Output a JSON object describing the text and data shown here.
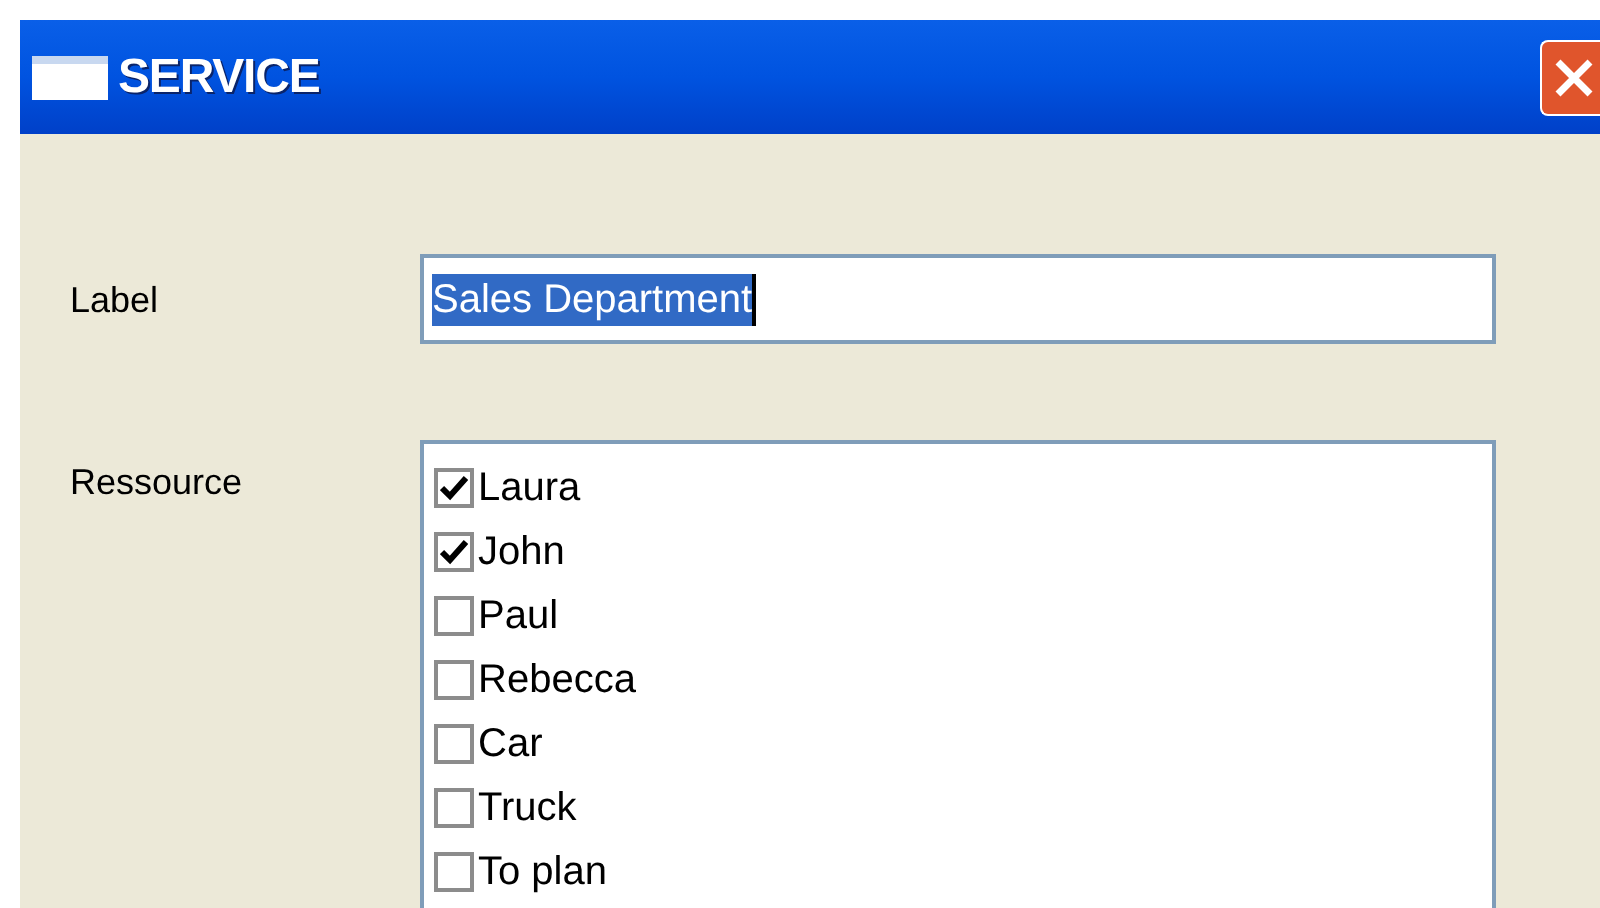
{
  "window": {
    "title": "SERVICE"
  },
  "label_field": {
    "label": "Label",
    "value": "Sales Department",
    "value_selected": true
  },
  "resources": {
    "label": "Ressource",
    "items": [
      {
        "label": "Laura",
        "checked": true
      },
      {
        "label": "John",
        "checked": true
      },
      {
        "label": "Paul",
        "checked": false
      },
      {
        "label": "Rebecca",
        "checked": false
      },
      {
        "label": "Car",
        "checked": false
      },
      {
        "label": "Truck",
        "checked": false
      },
      {
        "label": "To plan",
        "checked": false
      }
    ]
  }
}
